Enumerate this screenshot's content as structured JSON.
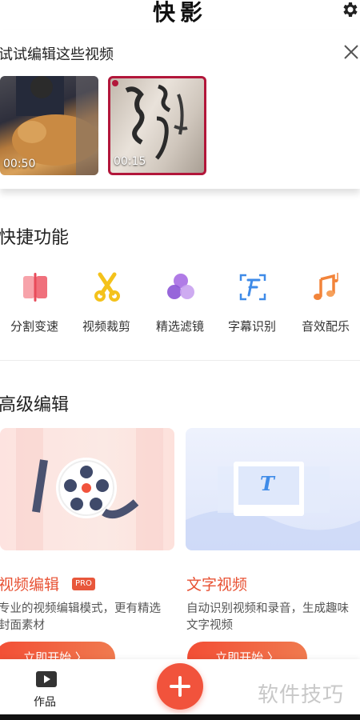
{
  "header": {
    "title": "快影",
    "settings_icon": "gear-icon"
  },
  "suggestion": {
    "title": "试试编辑这些视频",
    "close_icon": "close-icon",
    "videos": [
      {
        "duration": "00:50"
      },
      {
        "duration": "00:15"
      }
    ]
  },
  "quick": {
    "title": "快捷功能",
    "items": [
      {
        "label": "分割变速",
        "icon": "split-icon"
      },
      {
        "label": "视频裁剪",
        "icon": "scissors-icon"
      },
      {
        "label": "精选滤镜",
        "icon": "filter-icon"
      },
      {
        "label": "字幕识别",
        "icon": "subtitle-icon"
      },
      {
        "label": "音效配乐",
        "icon": "music-icon"
      }
    ]
  },
  "advanced": {
    "title": "高级编辑",
    "cards": [
      {
        "name": "视频编辑",
        "badge": "PRO",
        "desc": "专业的视频编辑模式，更有精选封面素材",
        "button": "立即开始 〉"
      },
      {
        "name": "文字视频",
        "desc": "自动识别视频和录音，生成趣味文字视频",
        "button": "立即开始 〉"
      }
    ]
  },
  "bottom_nav": {
    "works_label": "作品",
    "works_icon": "play-icon",
    "add_icon": "plus-icon"
  },
  "watermark": "软件技巧",
  "colors": {
    "accent": "#f1533c",
    "text": "#222222"
  }
}
